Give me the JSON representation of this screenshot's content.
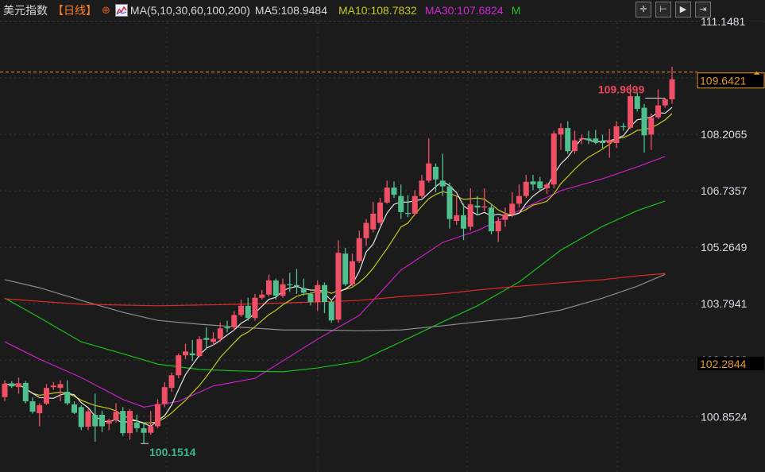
{
  "header": {
    "title": "美元指数",
    "period": "【日线】",
    "add_icon": "⊕",
    "ma_label": "MA(5,10,30,60,100,200)",
    "ma5": "MA5:108.9484",
    "ma10": "MA10:108.7832",
    "ma30": "MA30:107.6824",
    "m": "M"
  },
  "toolbar": {
    "buttons": [
      {
        "name": "crosshair-icon",
        "glyph": "✛"
      },
      {
        "name": "zoom-range-icon",
        "glyph": "⊢"
      },
      {
        "name": "play-icon",
        "glyph": "▶"
      },
      {
        "name": "exit-icon",
        "glyph": "⇥"
      }
    ]
  },
  "colors": {
    "up": "#ef5066",
    "down": "#4fbf8e",
    "ma5": "#e6e6e6",
    "ma10": "#c8c820",
    "ma30": "#c81ec8",
    "ma60": "#18c018",
    "ma100": "#8c8c8c",
    "ma200": "#e02828",
    "current": "#e8962a"
  },
  "chart_data": {
    "type": "candlestick",
    "title": "美元指数 日线",
    "y_ticks": [
      "111.1481",
      "109.6773",
      "108.2065",
      "106.7357",
      "105.2649",
      "103.7941",
      "102.3232",
      "100.8524"
    ],
    "ylim": [
      99.8,
      111.6
    ],
    "current_price": "109.6421",
    "tag_price": "102.2844",
    "max_label": "109.9699",
    "min_label": "100.1514",
    "max_index": 95,
    "min_index": 20,
    "candles_ohlc": [
      [
        101.36,
        101.8,
        101.25,
        101.71
      ],
      [
        101.72,
        101.78,
        101.6,
        101.64
      ],
      [
        101.62,
        101.87,
        101.45,
        101.72
      ],
      [
        101.73,
        101.78,
        101.2,
        101.25
      ],
      [
        101.25,
        101.35,
        100.93,
        100.98
      ],
      [
        100.94,
        101.2,
        100.6,
        101.15
      ],
      [
        101.19,
        101.7,
        101.15,
        101.6
      ],
      [
        101.62,
        101.75,
        101.55,
        101.66
      ],
      [
        101.6,
        101.8,
        101.25,
        101.7
      ],
      [
        101.5,
        101.8,
        101.15,
        101.2
      ],
      [
        101.17,
        101.25,
        100.92,
        100.95
      ],
      [
        101.1,
        101.15,
        100.5,
        100.58
      ],
      [
        100.59,
        101.05,
        100.5,
        100.99
      ],
      [
        100.9,
        101.45,
        100.2,
        100.6
      ],
      [
        100.9,
        101.0,
        100.45,
        100.6
      ],
      [
        100.67,
        100.8,
        100.5,
        100.76
      ],
      [
        100.76,
        101.2,
        100.7,
        100.98
      ],
      [
        101.0,
        101.1,
        100.35,
        100.42
      ],
      [
        100.42,
        101.05,
        100.25,
        101.0
      ],
      [
        100.7,
        100.9,
        100.45,
        100.55
      ],
      [
        100.55,
        100.7,
        100.15,
        100.43
      ],
      [
        100.43,
        101.0,
        100.38,
        100.6
      ],
      [
        100.6,
        101.3,
        100.55,
        101.18
      ],
      [
        101.18,
        101.75,
        101.1,
        101.62
      ],
      [
        101.6,
        102.0,
        101.5,
        101.93
      ],
      [
        101.93,
        102.5,
        101.85,
        102.45
      ],
      [
        102.45,
        102.75,
        102.35,
        102.55
      ],
      [
        102.5,
        102.85,
        102.3,
        102.45
      ],
      [
        102.43,
        102.95,
        102.4,
        102.87
      ],
      [
        102.9,
        103.18,
        102.6,
        102.85
      ],
      [
        102.8,
        103.05,
        102.7,
        102.88
      ],
      [
        102.88,
        103.3,
        102.8,
        103.15
      ],
      [
        103.18,
        103.35,
        103.05,
        103.15
      ],
      [
        103.18,
        103.6,
        103.1,
        103.5
      ],
      [
        103.5,
        103.9,
        103.45,
        103.74
      ],
      [
        103.74,
        103.95,
        103.35,
        103.42
      ],
      [
        103.42,
        104.05,
        103.35,
        103.95
      ],
      [
        103.95,
        104.15,
        103.9,
        104.03
      ],
      [
        104.03,
        104.55,
        103.98,
        104.4
      ],
      [
        104.4,
        104.45,
        103.9,
        104.0
      ],
      [
        104.0,
        104.45,
        103.95,
        104.3
      ],
      [
        104.3,
        104.6,
        104.1,
        104.28
      ],
      [
        104.28,
        104.7,
        104.05,
        104.25
      ],
      [
        104.2,
        104.45,
        104.0,
        104.08
      ],
      [
        104.05,
        104.1,
        103.75,
        103.84
      ],
      [
        103.84,
        104.4,
        103.6,
        104.28
      ],
      [
        104.28,
        104.35,
        103.55,
        103.84
      ],
      [
        103.84,
        103.9,
        103.3,
        103.36
      ],
      [
        103.38,
        105.45,
        103.3,
        105.12
      ],
      [
        105.1,
        105.25,
        104.25,
        104.3
      ],
      [
        104.3,
        105.1,
        104.25,
        104.9
      ],
      [
        104.9,
        105.7,
        104.85,
        105.5
      ],
      [
        105.5,
        106.0,
        105.3,
        105.9
      ],
      [
        105.73,
        106.45,
        105.65,
        106.14
      ],
      [
        105.9,
        106.55,
        105.85,
        106.43
      ],
      [
        106.43,
        107.0,
        106.4,
        106.82
      ],
      [
        106.82,
        106.98,
        106.55,
        106.63
      ],
      [
        106.6,
        106.9,
        106.0,
        106.18
      ],
      [
        106.16,
        106.62,
        106.05,
        106.14
      ],
      [
        106.14,
        106.75,
        106.1,
        106.6
      ],
      [
        106.6,
        107.15,
        106.55,
        107.0
      ],
      [
        107.0,
        108.1,
        106.95,
        107.45
      ],
      [
        107.36,
        107.45,
        106.7,
        107.03
      ],
      [
        107.0,
        107.7,
        106.6,
        106.85
      ],
      [
        106.85,
        106.95,
        105.75,
        106.0
      ],
      [
        105.95,
        106.6,
        105.85,
        106.1
      ],
      [
        106.1,
        106.4,
        105.45,
        105.75
      ],
      [
        105.8,
        106.8,
        105.7,
        106.38
      ],
      [
        106.35,
        106.6,
        106.1,
        106.3
      ],
      [
        106.3,
        106.8,
        106.2,
        106.33
      ],
      [
        106.3,
        106.4,
        105.6,
        105.68
      ],
      [
        105.68,
        106.05,
        105.4,
        105.95
      ],
      [
        105.98,
        106.3,
        105.8,
        106.12
      ],
      [
        106.12,
        106.7,
        106.05,
        106.4
      ],
      [
        106.4,
        106.9,
        106.3,
        106.6
      ],
      [
        106.6,
        107.15,
        106.55,
        106.97
      ],
      [
        106.98,
        107.15,
        106.75,
        106.9
      ],
      [
        106.98,
        107.1,
        106.75,
        106.8
      ],
      [
        106.8,
        106.95,
        106.65,
        106.9
      ],
      [
        106.9,
        108.3,
        106.8,
        108.23
      ],
      [
        108.2,
        108.5,
        107.8,
        108.37
      ],
      [
        108.37,
        108.55,
        107.7,
        107.77
      ],
      [
        107.77,
        108.3,
        107.7,
        108.05
      ],
      [
        108.07,
        108.2,
        107.95,
        108.1
      ],
      [
        108.1,
        108.3,
        107.95,
        108.05
      ],
      [
        108.1,
        108.32,
        107.95,
        108.0
      ],
      [
        108.03,
        108.2,
        107.85,
        107.98
      ],
      [
        107.98,
        108.35,
        107.6,
        108.05
      ],
      [
        107.98,
        108.55,
        107.85,
        108.42
      ],
      [
        108.42,
        108.5,
        108.3,
        108.4
      ],
      [
        108.38,
        109.51,
        108.35,
        109.2
      ],
      [
        109.2,
        109.3,
        108.8,
        108.87
      ],
      [
        108.9,
        109.0,
        107.73,
        108.18
      ],
      [
        108.2,
        108.75,
        107.8,
        108.65
      ],
      [
        108.65,
        109.38,
        108.6,
        108.96
      ],
      [
        108.96,
        109.15,
        108.9,
        109.12
      ],
      [
        109.12,
        109.9699,
        109.0,
        109.64
      ]
    ],
    "ma_lines": [
      {
        "name": "MA30",
        "color_key": "ma30",
        "points": [
          [
            0,
            102.8
          ],
          [
            5,
            102.35
          ],
          [
            11,
            101.87
          ],
          [
            17,
            101.3
          ],
          [
            20,
            101.1
          ],
          [
            25,
            101.25
          ],
          [
            30,
            101.65
          ],
          [
            36,
            101.85
          ],
          [
            45,
            102.87
          ],
          [
            51,
            103.49
          ],
          [
            57,
            104.67
          ],
          [
            63,
            105.39
          ],
          [
            68,
            105.7
          ],
          [
            74,
            106.22
          ],
          [
            80,
            106.74
          ],
          [
            86,
            107.05
          ],
          [
            91,
            107.36
          ],
          [
            95,
            107.63
          ]
        ]
      },
      {
        "name": "MA60",
        "color_key": "ma60",
        "points": [
          [
            0,
            103.94
          ],
          [
            5,
            103.43
          ],
          [
            11,
            102.8
          ],
          [
            17,
            102.49
          ],
          [
            22,
            102.22
          ],
          [
            28,
            102.08
          ],
          [
            34,
            102.04
          ],
          [
            40,
            102.02
          ],
          [
            45,
            102.12
          ],
          [
            51,
            102.29
          ],
          [
            57,
            102.8
          ],
          [
            63,
            103.32
          ],
          [
            68,
            103.74
          ],
          [
            74,
            104.36
          ],
          [
            80,
            105.19
          ],
          [
            86,
            105.81
          ],
          [
            91,
            106.22
          ],
          [
            95,
            106.47
          ]
        ]
      },
      {
        "name": "MA100",
        "color_key": "ma100",
        "points": [
          [
            0,
            104.42
          ],
          [
            5,
            104.21
          ],
          [
            11,
            103.88
          ],
          [
            17,
            103.57
          ],
          [
            22,
            103.36
          ],
          [
            28,
            103.26
          ],
          [
            34,
            103.18
          ],
          [
            40,
            103.11
          ],
          [
            45,
            103.11
          ],
          [
            51,
            103.09
          ],
          [
            57,
            103.11
          ],
          [
            63,
            103.22
          ],
          [
            68,
            103.32
          ],
          [
            74,
            103.43
          ],
          [
            80,
            103.63
          ],
          [
            86,
            103.94
          ],
          [
            91,
            104.25
          ],
          [
            95,
            104.56
          ]
        ]
      },
      {
        "name": "MA200",
        "color_key": "ma200",
        "points": [
          [
            0,
            103.92
          ],
          [
            11,
            103.78
          ],
          [
            22,
            103.74
          ],
          [
            34,
            103.78
          ],
          [
            45,
            103.84
          ],
          [
            51,
            103.88
          ],
          [
            57,
            103.98
          ],
          [
            63,
            104.05
          ],
          [
            68,
            104.15
          ],
          [
            74,
            104.25
          ],
          [
            80,
            104.34
          ],
          [
            86,
            104.42
          ],
          [
            91,
            104.52
          ],
          [
            95,
            104.58
          ]
        ]
      }
    ]
  }
}
